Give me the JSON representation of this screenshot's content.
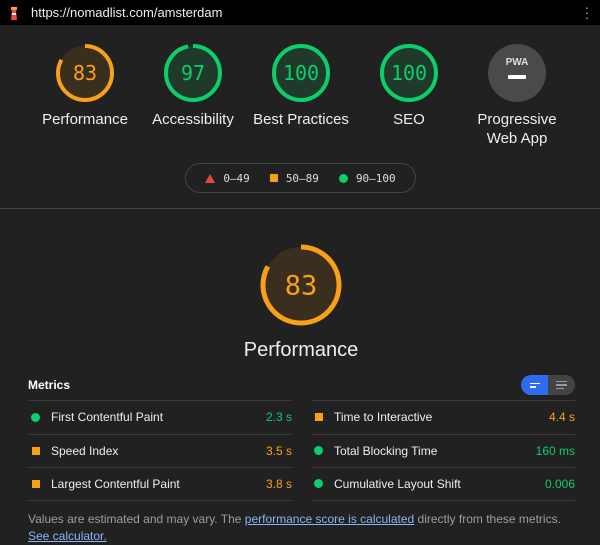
{
  "topbar": {
    "url": "https://nomadlist.com/amsterdam",
    "icon": "lighthouse-icon",
    "menu_icon": "more-vert-icon"
  },
  "colors": {
    "fail": "#e6473b",
    "average": "#f9a01b",
    "pass": "#0cce6b",
    "accent": "#2f6bf2"
  },
  "categories": [
    {
      "label": "Performance",
      "score": 83,
      "score_text": "83",
      "rating": "average"
    },
    {
      "label": "Accessibility",
      "score": 97,
      "score_text": "97",
      "rating": "pass"
    },
    {
      "label": "Best Practices",
      "score": 100,
      "score_text": "100",
      "rating": "pass"
    },
    {
      "label": "SEO",
      "score": 100,
      "score_text": "100",
      "rating": "pass"
    },
    {
      "label_line1": "Progressive",
      "label_line2": "Web App",
      "badge": "PWA",
      "rating": "na"
    }
  ],
  "legend": [
    {
      "icon": "triangle",
      "text": "0–49"
    },
    {
      "icon": "square",
      "text": "50–89"
    },
    {
      "icon": "circle",
      "text": "90–100"
    }
  ],
  "performance": {
    "score": 83,
    "score_text": "83",
    "label": "Performance"
  },
  "metrics": {
    "title": "Metrics",
    "left": [
      {
        "name": "First Contentful Paint",
        "value": "2.3 s",
        "rating": "pass"
      },
      {
        "name": "Speed Index",
        "value": "3.5 s",
        "rating": "average"
      },
      {
        "name": "Largest Contentful Paint",
        "value": "3.8 s",
        "rating": "average"
      }
    ],
    "right": [
      {
        "name": "Time to Interactive",
        "value": "4.4 s",
        "rating": "average"
      },
      {
        "name": "Total Blocking Time",
        "value": "160 ms",
        "rating": "pass"
      },
      {
        "name": "Cumulative Layout Shift",
        "value": "0.006",
        "rating": "pass"
      }
    ]
  },
  "footer": {
    "text1": "Values are estimated and may vary. The ",
    "link1": "performance score is calculated",
    "text2": " directly from these metrics. ",
    "link2": "See calculator."
  }
}
